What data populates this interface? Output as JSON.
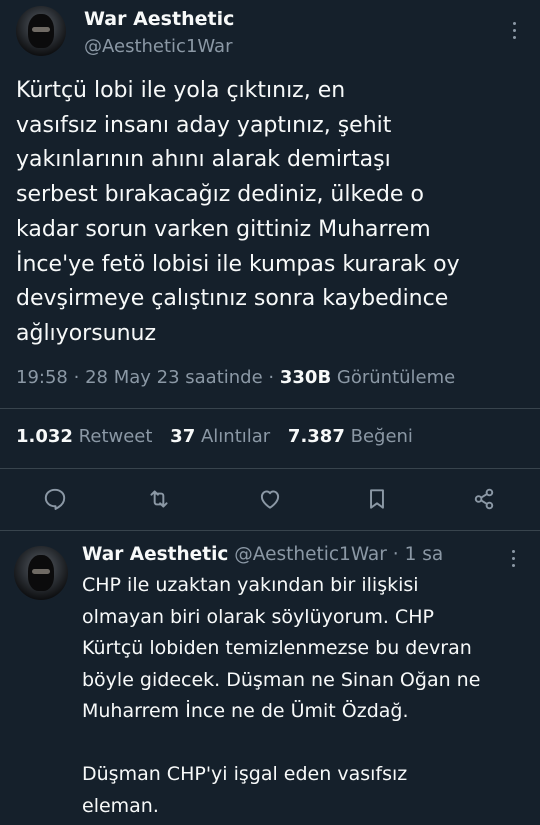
{
  "tweet": {
    "author_name": "War Aesthetic",
    "author_handle": "@Aesthetic1War",
    "text": "Kürtçü lobi ile yola çıktınız, en\nvasıfsız insanı aday yaptınız, şehit\nyakınlarının ahını alarak demirtaşı\nserbest bırakacağız dediniz, ülkede o\nkadar sorun varken gittiniz Muharrem\nİnce'ye fetö lobisi ile kumpas kurarak oy\ndevşirmeye çalıştınız sonra kaybedince\nağlıyorsunuz",
    "time": "19:58",
    "separator": "·",
    "date": "28 May 23 saatinde",
    "views_count": "330B",
    "views_label": "Görüntüleme",
    "retweets_count": "1.032",
    "retweets_label": "Retweet",
    "quotes_count": "37",
    "quotes_label": "Alıntılar",
    "likes_count": "7.387",
    "likes_label": "Beğeni"
  },
  "actions": {
    "icons": [
      "reply-icon",
      "retweet-icon",
      "like-icon",
      "bookmark-icon",
      "share-icon"
    ]
  },
  "reply": {
    "author_name": "War Aesthetic",
    "author_handle": "@Aesthetic1War",
    "separator": "·",
    "age": "1 sa",
    "text": "CHP ile uzaktan yakından bir ilişkisi\nolmayan biri olarak söylüyorum. CHP\nKürtçü lobiden temizlenmezse bu devran\nböyle gidecek. Düşman ne Sinan Oğan ne\nMuharrem İnce ne de Ümit Özdağ.\n\nDüşman CHP'yi işgal eden vasıfsız\neleman."
  },
  "colors": {
    "background": "#15202b",
    "text": "#f7f9f9",
    "muted": "#8b98a5",
    "divider": "#38444d"
  }
}
